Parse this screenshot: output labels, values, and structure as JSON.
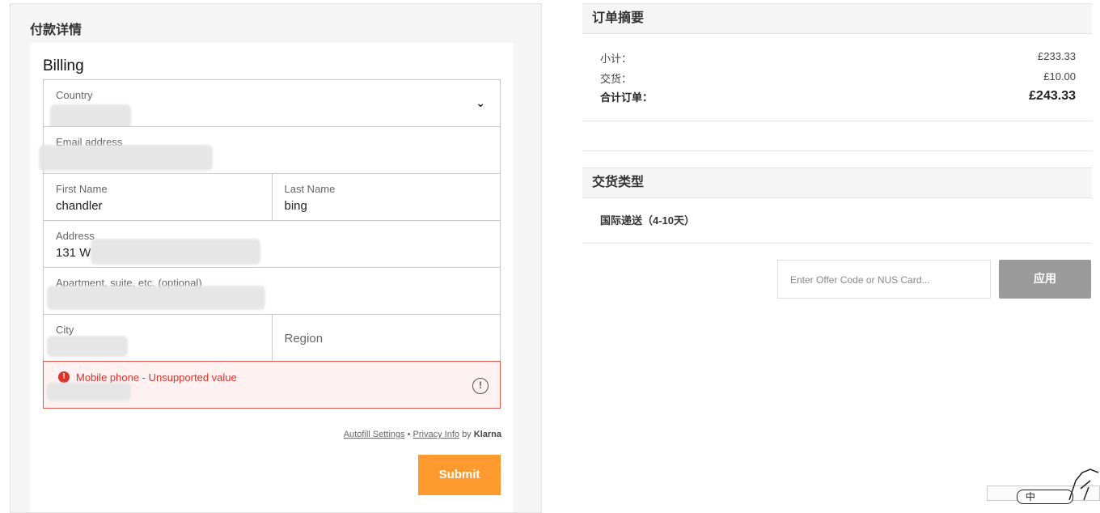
{
  "left": {
    "payment_title": "付款详情",
    "billing_title": "Billing",
    "fields": {
      "country_label": "Country",
      "email_label": "Email address",
      "first_name_label": "First Name",
      "first_name_value": "chandler",
      "last_name_label": "Last Name",
      "last_name_value": "bing",
      "address_label": "Address",
      "address_value": "131 W",
      "apartment_label": "Apartment, suite, etc. (optional)",
      "city_label": "City",
      "region_placeholder": "Region",
      "error_text": "Mobile phone - Unsupported value"
    },
    "legal": {
      "autofill": "Autofill Settings",
      "separator": "•",
      "privacy": "Privacy Info",
      "by": "by",
      "brand": "Klarna"
    },
    "submit_label": "Submit"
  },
  "right": {
    "order_summary_title": "订单摘要",
    "subtotal_label": "小计：",
    "subtotal_value": "£233.33",
    "delivery_label": "交货：",
    "delivery_value": "£10.00",
    "total_label": "合计订单：",
    "total_value": "£243.33",
    "delivery_type_title": "交货类型",
    "delivery_option": "国际递送（4-10天）",
    "offer_placeholder": "Enter Offer Code or NUS Card...",
    "apply_label": "应用"
  },
  "widget": {
    "lang": "中"
  },
  "colors": {
    "submit": "#ff9a2e",
    "error": "#d9342b",
    "apply": "#9b9b9b"
  },
  "icons": [
    "chevron-down-icon",
    "error-icon",
    "warning-circle-icon"
  ]
}
